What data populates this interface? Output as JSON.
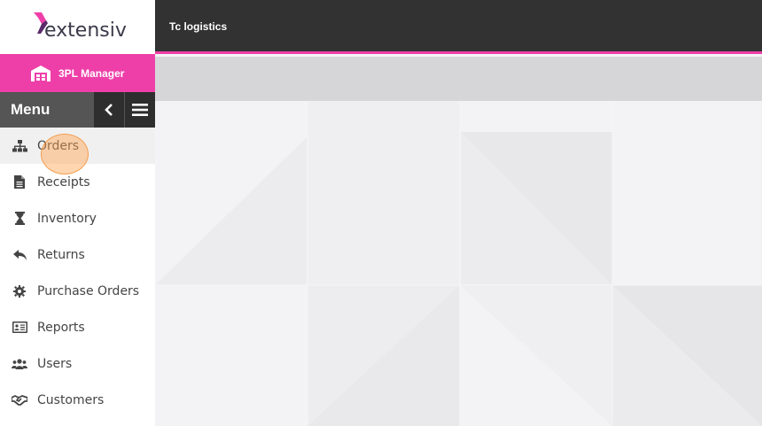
{
  "brand": {
    "name": "extensiv",
    "product": "3PL Manager"
  },
  "topbar": {
    "title": "Tc logistics"
  },
  "menu": {
    "title": "Menu",
    "items": [
      {
        "label": "Orders",
        "icon": "sitemap-icon",
        "name": "orders"
      },
      {
        "label": "Receipts",
        "icon": "document-icon",
        "name": "receipts"
      },
      {
        "label": "Inventory",
        "icon": "hourglass-icon",
        "name": "inventory"
      },
      {
        "label": "Returns",
        "icon": "reply-icon",
        "name": "returns"
      },
      {
        "label": "Purchase Orders",
        "icon": "gear-icon",
        "name": "purchase-orders"
      },
      {
        "label": "Reports",
        "icon": "id-card-icon",
        "name": "reports"
      },
      {
        "label": "Users",
        "icon": "users-icon",
        "name": "users"
      },
      {
        "label": "Customers",
        "icon": "handshake-icon",
        "name": "customers"
      }
    ]
  },
  "colors": {
    "accent": "#ee3fa9",
    "topbar": "#323232",
    "menu_header": "#555555"
  }
}
